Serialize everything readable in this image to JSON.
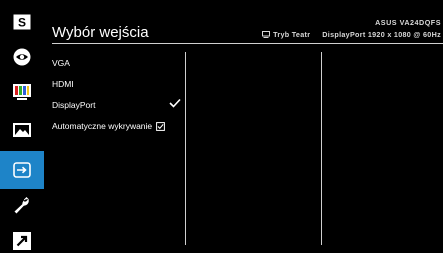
{
  "header": {
    "title": "Wybór wejścia",
    "model": "ASUS VA24DQFS",
    "mode": "Tryb Teatr",
    "input_info": "DisplayPort 1920 x 1080 @ 60Hz"
  },
  "sidebar": {
    "items": [
      {
        "icon": "splendid-s-icon",
        "active": false
      },
      {
        "icon": "eye-care-icon",
        "active": false
      },
      {
        "icon": "color-bars-icon",
        "active": false
      },
      {
        "icon": "image-icon",
        "active": false
      },
      {
        "icon": "input-select-icon",
        "active": true
      },
      {
        "icon": "wrench-icon",
        "active": false
      },
      {
        "icon": "shortcut-arrow-icon",
        "active": false
      }
    ]
  },
  "options": [
    {
      "label": "VGA",
      "selected": false
    },
    {
      "label": "HDMI",
      "selected": false
    },
    {
      "label": "DisplayPort",
      "selected": true
    },
    {
      "label": "Automatyczne wykrywanie",
      "checkbox": true,
      "checked": true
    }
  ],
  "colors": {
    "accent": "#1e84c8",
    "background": "#000000",
    "text": "#ffffff"
  }
}
